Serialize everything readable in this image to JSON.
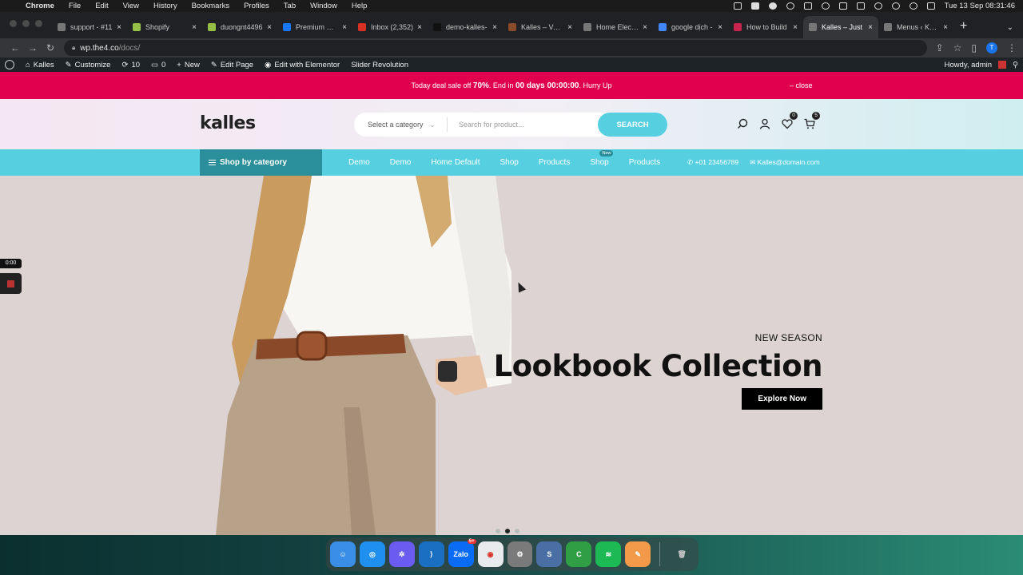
{
  "mac": {
    "app": "Chrome",
    "menus": [
      "File",
      "Edit",
      "View",
      "History",
      "Bookmarks",
      "Profiles",
      "Tab",
      "Window",
      "Help"
    ],
    "clock": "Tue 13 Sep  08:31:46"
  },
  "tabs": [
    {
      "title": "support - #11",
      "color": "#777"
    },
    {
      "title": "Shopify",
      "color": "#95bf47"
    },
    {
      "title": "duongnt4496",
      "color": "#95bf47"
    },
    {
      "title": "Premium Sho",
      "color": "#1877f2"
    },
    {
      "title": "Inbox (2,352)",
      "color": "#d93025"
    },
    {
      "title": "demo-kalles-",
      "color": "#111"
    },
    {
      "title": "Kalles – Versa",
      "color": "#8a4b2a"
    },
    {
      "title": "Home Electric",
      "color": "#777"
    },
    {
      "title": "google dịch -",
      "color": "#4285f4"
    },
    {
      "title": "How to Build",
      "color": "#c7254e"
    },
    {
      "title": "Kalles – Just",
      "color": "#777",
      "active": true
    },
    {
      "title": "Menus ‹ Kalle",
      "color": "#777"
    }
  ],
  "browser": {
    "url_host": "wp.the4.co",
    "url_path": "/docs/",
    "profile_initial": "T"
  },
  "wpbar": {
    "site": "Kalles",
    "customize": "Customize",
    "updates": "10",
    "comments": "0",
    "new": "New",
    "edit_page": "Edit Page",
    "elementor": "Edit with Elementor",
    "slider": "Slider Revolution",
    "howdy": "Howdy, admin"
  },
  "promo": {
    "text_a": "Today deal sale off",
    "percent": "70%",
    "text_b": ". End in",
    "countdown": "00 days 00:00:00",
    "text_c": ". Hurry Up",
    "close": "– close"
  },
  "header": {
    "logo": "kalles",
    "category_select": "Select a category",
    "search_placeholder": "Search for product...",
    "search_button": "SEARCH",
    "wishlist_count": "0",
    "cart_count": "5"
  },
  "nav": {
    "shop_by_category": "Shop by category",
    "links": [
      "Demo",
      "Demo",
      "Home Default",
      "Shop",
      "Products",
      "Shop",
      "Products"
    ],
    "new_badge": "New",
    "phone": "+01 23456789",
    "email": "Kalles@domain.com"
  },
  "hero": {
    "eyebrow": "NEW SEASON",
    "title": "Lookbook Collection",
    "button": "Explore Now"
  },
  "recorder": {
    "time": "0:00"
  },
  "dock": [
    "Finder",
    "Safari",
    "Screen",
    "VS Code",
    "Zalo",
    "Chrome",
    "Settings",
    "Sublime",
    "Camtasia",
    "Spotify",
    "Pages",
    "Trash"
  ],
  "dock_badge": "5+",
  "colors": {
    "promo": "#e0004d",
    "accent": "#56cfe1",
    "accent_dark": "#2a8f9a"
  }
}
